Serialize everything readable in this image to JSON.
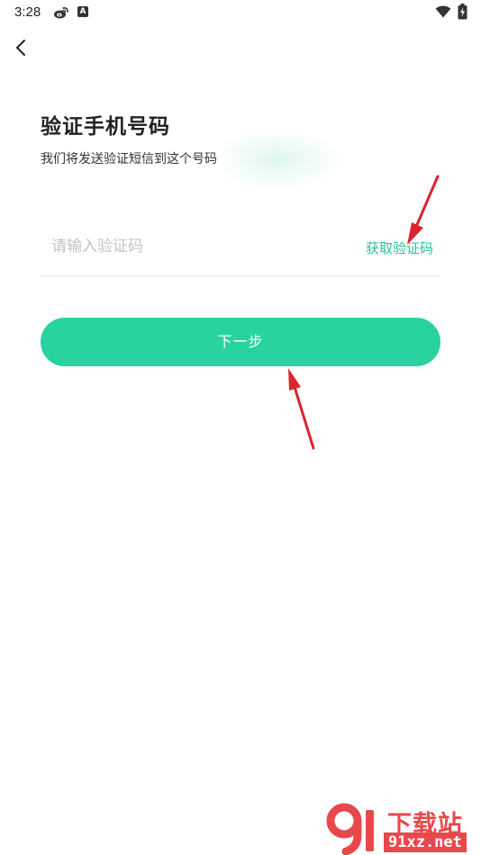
{
  "status_bar": {
    "time": "3:28",
    "app_icon_letter": "A",
    "icons": [
      "weibo-icon",
      "app-a-icon",
      "wifi-icon",
      "battery-charging-icon"
    ]
  },
  "header": {
    "back_icon": "chevron-left-icon"
  },
  "main": {
    "title": "验证手机号码",
    "subtitle": "我们将发送验证短信到这个号码",
    "code_input": {
      "value": "",
      "placeholder": "请输入验证码"
    },
    "get_code_label": "获取验证码",
    "next_label": "下一步"
  },
  "colors": {
    "accent": "#29d3a0",
    "accent_text": "#29c398",
    "annotation": "#d9262c",
    "watermark": "#e8484c"
  },
  "watermark": {
    "title": "下载站",
    "url": "91xz.net"
  }
}
